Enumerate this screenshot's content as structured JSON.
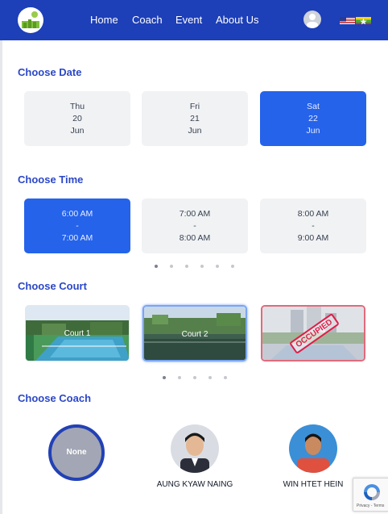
{
  "header": {
    "nav": [
      "Home",
      "Coach",
      "Event",
      "About Us"
    ],
    "accent": "#1d3fb8"
  },
  "sections": {
    "date_title": "Choose Date",
    "time_title": "Choose Time",
    "court_title": "Choose Court",
    "coach_title": "Choose Coach"
  },
  "dates": [
    {
      "day": "Thu",
      "date": "20",
      "month": "Jun",
      "selected": false
    },
    {
      "day": "Fri",
      "date": "21",
      "month": "Jun",
      "selected": false
    },
    {
      "day": "Sat",
      "date": "22",
      "month": "Jun",
      "selected": true
    }
  ],
  "times": [
    {
      "start": "6:00 AM",
      "sep": "-",
      "end": "7:00 AM",
      "selected": true
    },
    {
      "start": "7:00 AM",
      "sep": "-",
      "end": "8:00 AM",
      "selected": false
    },
    {
      "start": "8:00 AM",
      "sep": "-",
      "end": "9:00 AM",
      "selected": false
    }
  ],
  "courts": [
    {
      "label": "Court 1",
      "state": "available"
    },
    {
      "label": "Court 2",
      "state": "selected"
    },
    {
      "label": "",
      "state": "occupied",
      "stamp": "OCCUPIED"
    }
  ],
  "coaches": {
    "none_label": "None",
    "names": [
      "AUNG KYAW NAING",
      "WIN HTET HEIN"
    ]
  },
  "recaptcha": {
    "links": "Privacy - Terms"
  },
  "colors": {
    "primary": "#2563eb",
    "title": "#2b47c7",
    "occupied": "#e11d48"
  }
}
